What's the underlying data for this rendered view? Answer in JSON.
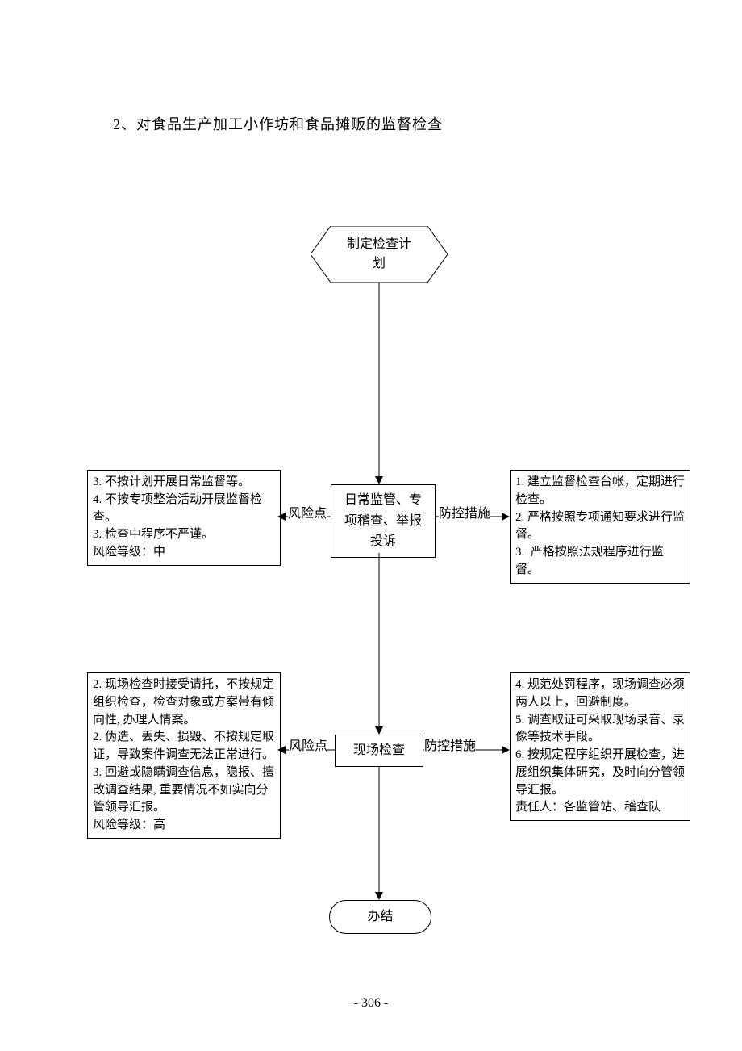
{
  "title": "2、对食品生产加工小作坊和食品摊贩的监督检查",
  "page_number": "- 306 -",
  "nodes": {
    "start": "制定检查计\n划",
    "supervision": "日常监管、专\n项稽查、举报\n投诉",
    "inspection": "现场检查",
    "end": "办结"
  },
  "edge_labels": {
    "risk_point_1": "风险点",
    "prevention_1": "防控措施",
    "risk_point_2": "风险点",
    "prevention_2": "防控措施"
  },
  "left_box_1": "3. 不按计划开展日常监督等。\n4. 不按专项整治活动开展监督检查。\n3. 检查中程序不严谨。\n风险等级：中",
  "right_box_1": "1. 建立监督检查台帐，定期进行检查。\n2. 严格按照专项通知要求进行监督。\n3.  严格按照法规程序进行监督。",
  "left_box_2": "2. 现场检查时接受请托，不按规定组织检查，检查对象或方案带有倾向性, 办理人情案。\n2. 伪造、丢失、损毁、不按规定取证，导致案件调查无法正常进行。\n3. 回避或隐瞒调查信息，隐报、擅改调查结果, 重要情况不如实向分管领导汇报。\n风险等级：高",
  "right_box_2": "4. 规范处罚程序，现场调查必须两人以上，回避制度。\n5. 调查取证可采取现场录音、录像等技术手段。\n6. 按规定程序组织开展检查，进展组织集体研究，及时向分管领导汇报。\n责任人：各监管站、稽查队"
}
